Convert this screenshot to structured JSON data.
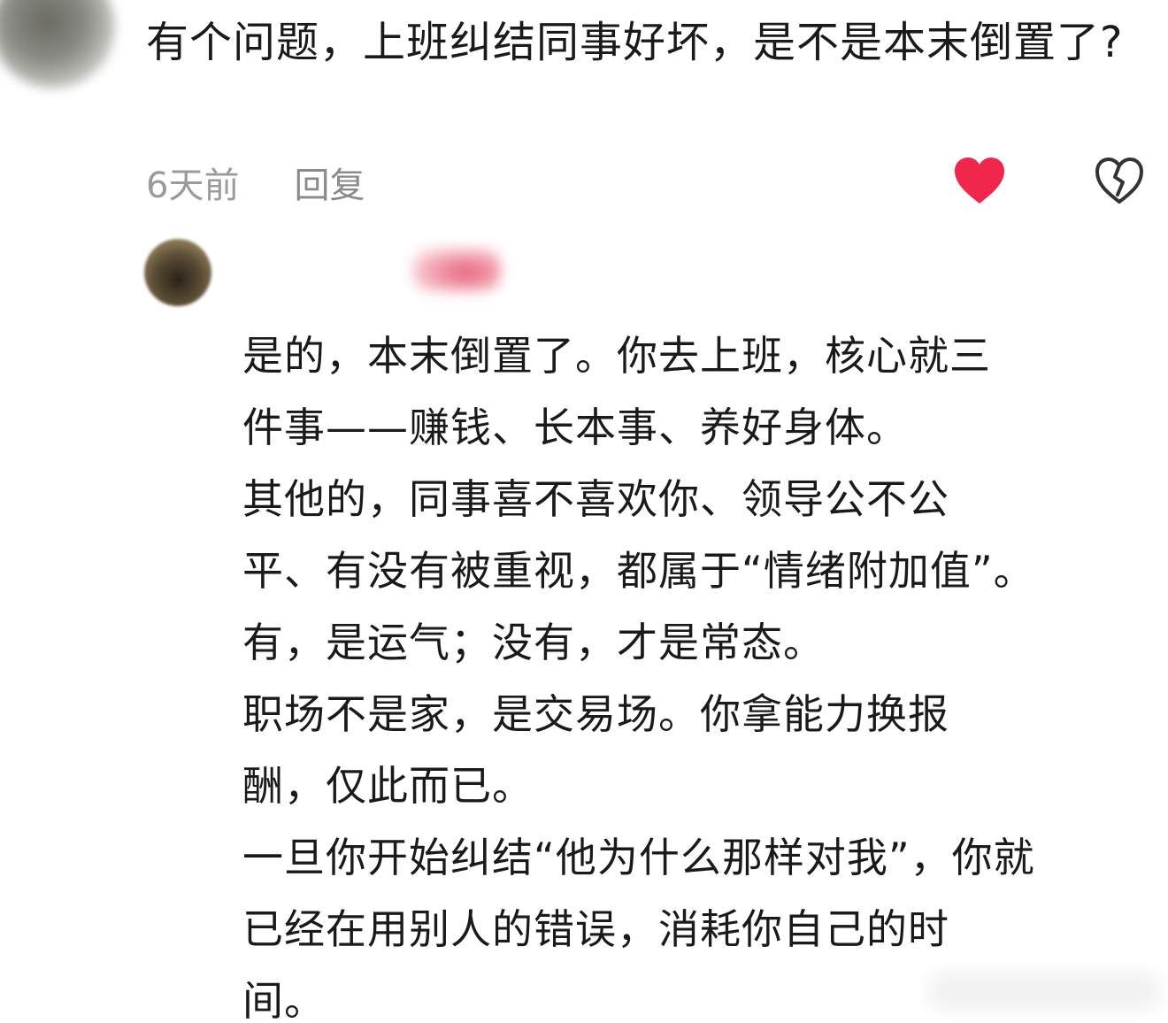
{
  "colors": {
    "text": "#1a1a1a",
    "meta": "#9a9a9a",
    "like": "#f0264a",
    "dislike": "#333333"
  },
  "comment": {
    "text": "有个问题，上班纠结同事好坏，是不是本末倒置了?",
    "time": "6天前",
    "reply_label": "回复",
    "like_icon": "heart-filled-icon",
    "dislike_icon": "broken-heart-icon"
  },
  "reply": {
    "lines": [
      "是的，本末倒置了。你去上班，核心就三",
      "件事——赚钱、长本事、养好身体。",
      "其他的，同事喜不喜欢你、领导公不公",
      "平、有没有被重视，都属于“情绪附加值”。",
      "有，是运气；没有，才是常态。",
      "职场不是家，是交易场。你拿能力换报",
      "酬，仅此而已。",
      "一旦你开始纠结“他为什么那样对我”，你就",
      "已经在用别人的错误，消耗你自己的时",
      "间。"
    ]
  }
}
